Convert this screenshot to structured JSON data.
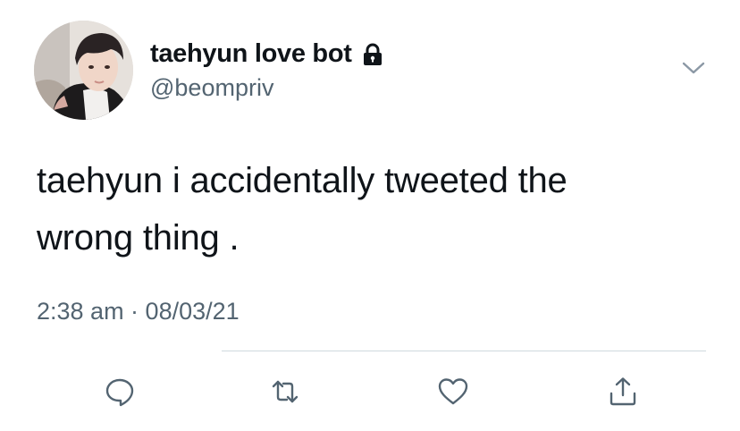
{
  "tweet": {
    "author": {
      "display_name": "taehyun love bot",
      "handle": "@beompriv",
      "protected_icon": "lock-icon",
      "avatar": "profile-photo"
    },
    "menu_icon": "chevron-down-icon",
    "text_line1": "taehyun i accidentally tweeted the",
    "text_line2": "wrong thing .",
    "timestamp": "2:38 am · 08/03/21"
  },
  "actions": [
    {
      "name": "reply",
      "icon": "reply-icon"
    },
    {
      "name": "retweet",
      "icon": "retweet-icon"
    },
    {
      "name": "like",
      "icon": "heart-icon"
    },
    {
      "name": "share",
      "icon": "share-icon"
    }
  ],
  "colors": {
    "text_primary": "#0f1419",
    "text_secondary": "#536471",
    "divider": "#cfd9de",
    "background": "#ffffff"
  }
}
